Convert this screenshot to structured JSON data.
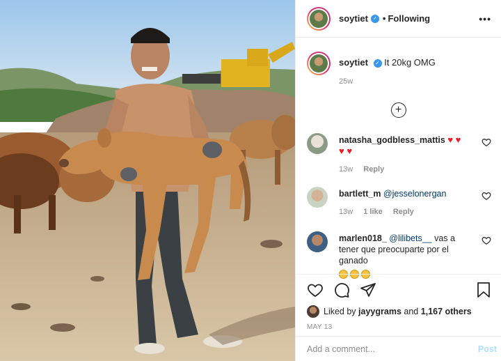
{
  "post": {
    "username": "soytiet",
    "follow_status": "Following",
    "more_label": "•••"
  },
  "caption": {
    "username": "soytiet",
    "text": "It 20kg OMG",
    "time": "25w"
  },
  "load_more_label": "+",
  "comments": [
    {
      "username": "natasha_godbless_mattis",
      "text": "",
      "emoji": "♥ ♥",
      "emoji2": "♥ ♥",
      "time": "13w",
      "likes": "",
      "reply": "Reply"
    },
    {
      "username": "bartlett_m",
      "text": "@jesselonergan",
      "time": "13w",
      "likes": "1 like",
      "reply": "Reply"
    },
    {
      "username": "marlen018_",
      "mention": "@lilibets__",
      "text": " vas a tener que preocuparte por el ganado",
      "emoji_count": 3
    }
  ],
  "likes": {
    "prefix": "Liked by ",
    "user": "jayygrams",
    "middle": " and ",
    "count": "1,167 others"
  },
  "date": "MAY 13",
  "add_comment": {
    "placeholder": "Add a comment...",
    "post_label": "Post"
  },
  "icons": [
    "heart-icon",
    "comment-icon",
    "share-icon",
    "bookmark-icon",
    "verified-icon",
    "more-icon"
  ],
  "colors": {
    "verified": "#3897f0",
    "post_button": "#b2dffc",
    "secondary_text": "#8e8e8e",
    "heart_red": "#ed4956"
  }
}
